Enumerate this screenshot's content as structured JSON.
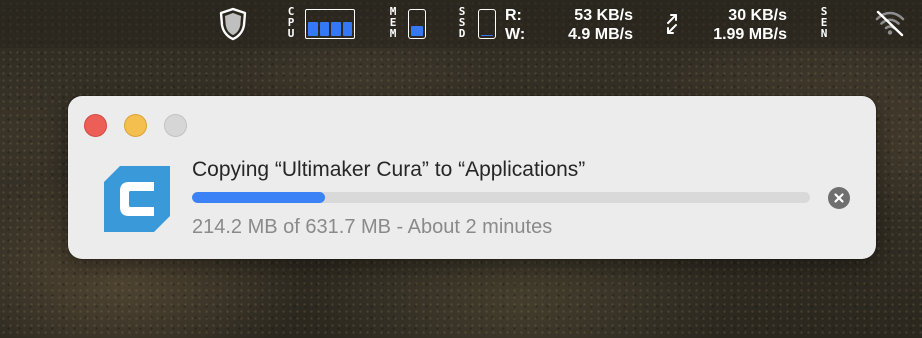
{
  "menubar": {
    "shield_icon": "shield-icon",
    "cpu": {
      "label": "CPU",
      "core_levels": [
        0.6,
        0.6,
        0.6,
        0.6
      ],
      "color": "#3478f6"
    },
    "memory": {
      "label": "MEM",
      "level": 0.45,
      "color": "#3478f6"
    },
    "ssd": {
      "label": "SSD",
      "level": 0.06,
      "color": "#3478f6",
      "read_label": "R:",
      "write_label": "W:",
      "read_value": "53 KB/s",
      "write_value": "4.9 MB/s"
    },
    "network": {
      "icon": "arrows-up-down-icon",
      "upload_value": "30 KB/s",
      "download_value": "1.99 MB/s"
    },
    "sensors": {
      "label": "SEN"
    },
    "wifi_icon": "wifi-off-icon"
  },
  "copy_dialog": {
    "title": "Copying “Ultimaker Cura” to “Applications”",
    "status": "214.2 MB of 631.7 MB - About 2 minutes",
    "progress_fraction": 0.216,
    "progress_color": "#3b82f6",
    "app_icon": "ultimaker-cura-icon",
    "app_icon_color": "#3a9ad9",
    "cancel_icon": "close-circle-icon"
  }
}
